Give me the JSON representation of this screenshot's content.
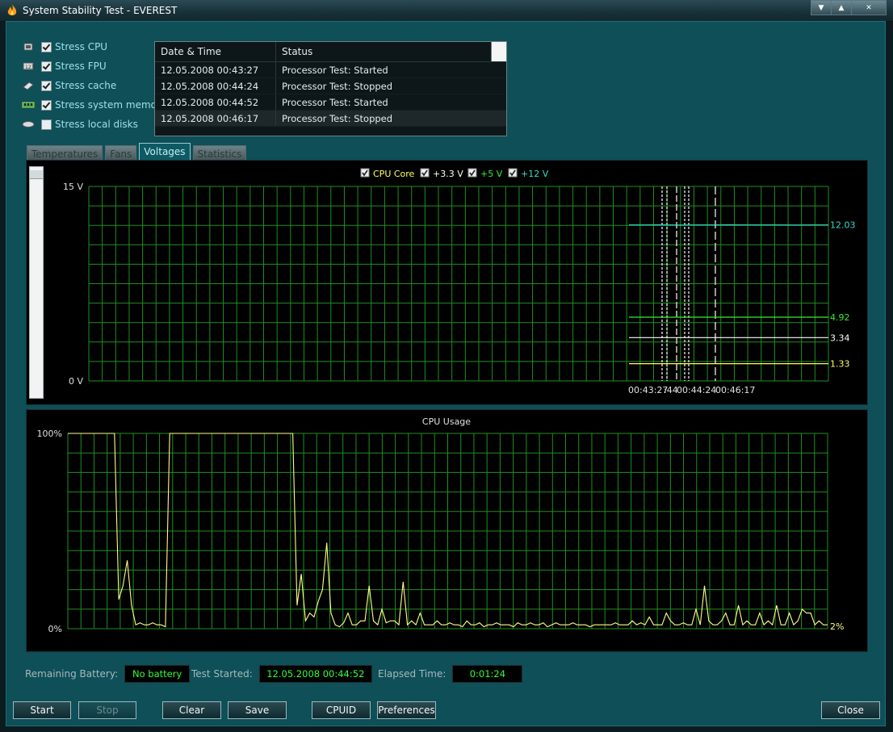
{
  "window": {
    "title": "System Stability Test - EVEREST"
  },
  "stress_options": [
    {
      "label": "Stress CPU",
      "checked": true,
      "icon": "cpu-icon"
    },
    {
      "label": "Stress FPU",
      "checked": true,
      "icon": "fpu-icon"
    },
    {
      "label": "Stress cache",
      "checked": true,
      "icon": "cache-icon"
    },
    {
      "label": "Stress system memory",
      "checked": true,
      "icon": "memory-icon"
    },
    {
      "label": "Stress local disks",
      "checked": false,
      "icon": "disk-icon"
    }
  ],
  "log": {
    "columns": [
      "Date & Time",
      "Status"
    ],
    "rows": [
      [
        "12.05.2008 00:43:27",
        "Processor Test: Started"
      ],
      [
        "12.05.2008 00:44:24",
        "Processor Test: Stopped"
      ],
      [
        "12.05.2008 00:44:52",
        "Processor Test: Started"
      ],
      [
        "12.05.2008 00:46:17",
        "Processor Test: Stopped"
      ]
    ]
  },
  "tabs": [
    "Temperatures",
    "Fans",
    "Voltages",
    "Statistics"
  ],
  "active_tab": "Voltages",
  "colors": {
    "grid": "#1f8f1f",
    "core": "#ffff66",
    "v33": "#ffffff",
    "v5": "#33ee33",
    "v12": "#33ddcc",
    "usage": "#ffff88"
  },
  "chart_data": [
    {
      "type": "line",
      "legend": [
        {
          "name": "CPU Core",
          "checked": true
        },
        {
          "name": "+3.3 V",
          "checked": true
        },
        {
          "name": "+5 V",
          "checked": true
        },
        {
          "name": "+12 V",
          "checked": true
        }
      ],
      "ylim": [
        0,
        15
      ],
      "ytick_labels": [
        "15 V",
        "0 V"
      ],
      "series": [
        {
          "name": "+12 V",
          "values": [
            12.03,
            12.03,
            12.04,
            12.02,
            12.03,
            12.03,
            12.04,
            12.03,
            12.03,
            12.03,
            12.02,
            12.03,
            12.03
          ],
          "current_label": "12.03"
        },
        {
          "name": "+5 V",
          "values": [
            4.92,
            4.92,
            4.92,
            4.92,
            4.92,
            4.92,
            4.92,
            4.92,
            4.92,
            4.92,
            4.92,
            4.92,
            4.92
          ],
          "current_label": "4.92"
        },
        {
          "name": "+3.3 V",
          "values": [
            3.34,
            3.34,
            3.34,
            3.34,
            3.34,
            3.34,
            3.34,
            3.34,
            3.34,
            3.34,
            3.34,
            3.34,
            3.34
          ],
          "current_label": "3.34"
        },
        {
          "name": "CPU Core",
          "values": [
            1.33,
            1.33,
            1.33,
            1.33,
            1.33,
            1.33,
            1.33,
            1.33,
            1.33,
            1.33,
            1.33,
            1.33,
            1.33
          ],
          "current_label": "1.33"
        }
      ],
      "time_labels": [
        "00:43:27",
        ":44",
        "00:44:24",
        "00:46:17"
      ]
    },
    {
      "type": "line",
      "title": "CPU Usage",
      "ylim": [
        0,
        100
      ],
      "ytick_labels": [
        "100%",
        "0%"
      ],
      "series": [
        {
          "name": "CPU Usage",
          "values": [
            100,
            100,
            100,
            100,
            100,
            100,
            100,
            100,
            100,
            100,
            100,
            100,
            15,
            22,
            35,
            12,
            2,
            3,
            2,
            2,
            3,
            2,
            2,
            1,
            100,
            100,
            100,
            100,
            100,
            100,
            100,
            100,
            100,
            100,
            100,
            100,
            100,
            100,
            100,
            100,
            100,
            100,
            100,
            100,
            100,
            100,
            100,
            100,
            100,
            100,
            100,
            100,
            100,
            100,
            12,
            28,
            4,
            8,
            6,
            14,
            20,
            44,
            8,
            2,
            1,
            3,
            8,
            2,
            2,
            4,
            4,
            22,
            4,
            2,
            10,
            3,
            4,
            4,
            2,
            24,
            2,
            4,
            2,
            8,
            2,
            2,
            2,
            4,
            2,
            2,
            3,
            2,
            2,
            1,
            4,
            2,
            2,
            3,
            1,
            2,
            2,
            3,
            2,
            2,
            2,
            1,
            3,
            2,
            2,
            3,
            2,
            2,
            3,
            1,
            2,
            3,
            2,
            2,
            2,
            3,
            2,
            2,
            2,
            1,
            2,
            2,
            2,
            2,
            2,
            3,
            2,
            2,
            2,
            4,
            2,
            3,
            2,
            6,
            2,
            2,
            2,
            8,
            4,
            2,
            2,
            3,
            2,
            2,
            10,
            2,
            22,
            4,
            2,
            2,
            4,
            8,
            2,
            2,
            12,
            2,
            4,
            2,
            2,
            8,
            2,
            4,
            2,
            12,
            2,
            2,
            8,
            2,
            4,
            10,
            8,
            8,
            2,
            4,
            2,
            2
          ],
          "current_label": "2%"
        }
      ]
    }
  ],
  "status_bar": {
    "battery_label": "Remaining Battery:",
    "battery_value": "No battery",
    "started_label": "Test Started:",
    "started_value": "12.05.2008 00:44:52",
    "elapsed_label": "Elapsed Time:",
    "elapsed_value": "0:01:24"
  },
  "buttons": {
    "start": "Start",
    "stop": "Stop",
    "clear": "Clear",
    "save": "Save",
    "cpuid": "CPUID",
    "preferences": "Preferences",
    "close": "Close"
  }
}
